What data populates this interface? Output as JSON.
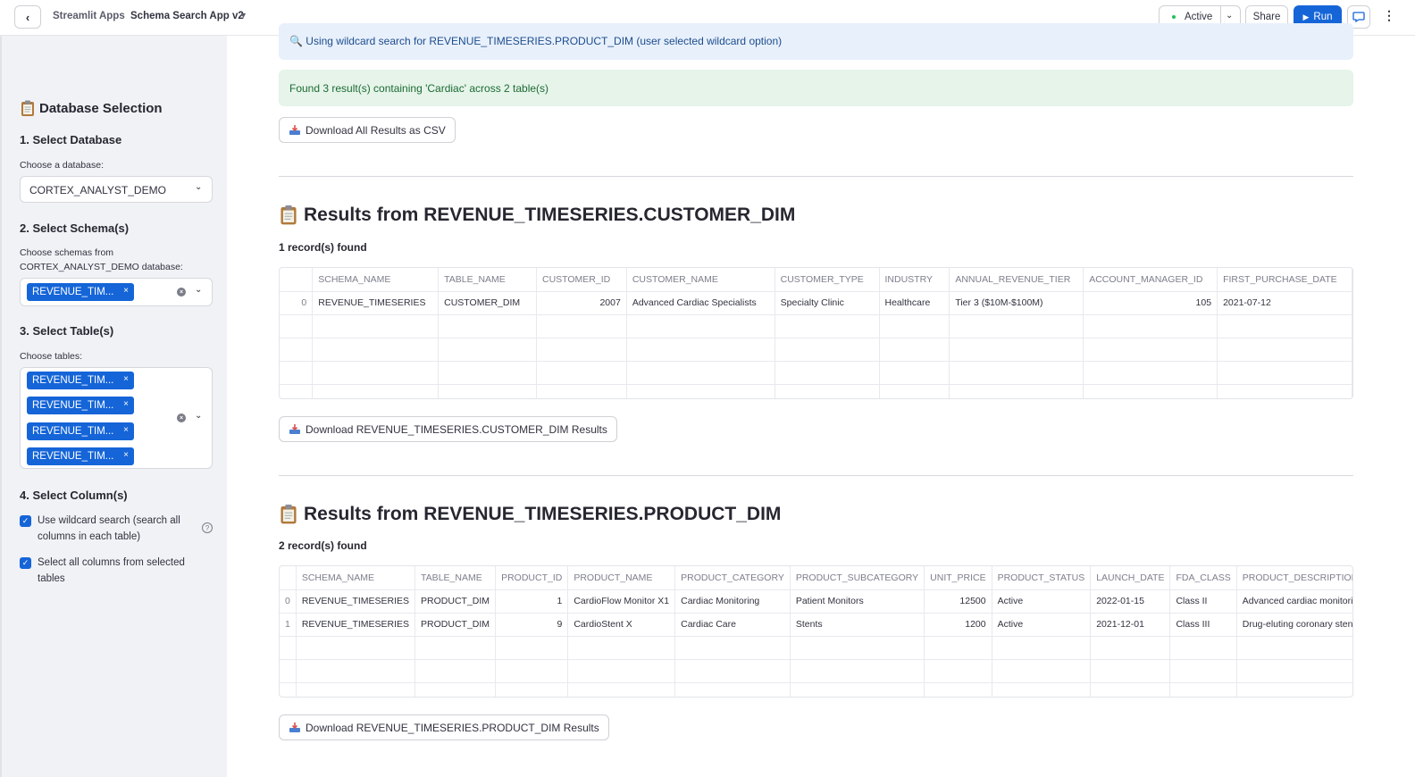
{
  "topbar": {
    "breadcrumb_apps": "Streamlit Apps",
    "app_name": "Schema Search App v2",
    "status_label": "Active",
    "share_label": "Share",
    "run_label": "Run"
  },
  "sidebar": {
    "title": "Database Selection",
    "step1": {
      "heading": "1. Select Database",
      "label": "Choose a database:",
      "value": "CORTEX_ANALYST_DEMO"
    },
    "step2": {
      "heading": "2. Select Schema(s)",
      "label": "Choose schemas from CORTEX_ANALYST_DEMO database:",
      "tags": [
        "REVENUE_TIM..."
      ]
    },
    "step3": {
      "heading": "3. Select Table(s)",
      "label": "Choose tables:",
      "tags": [
        "REVENUE_TIM...",
        "REVENUE_TIM...",
        "REVENUE_TIM...",
        "REVENUE_TIM..."
      ]
    },
    "step4": {
      "heading": "4. Select Column(s)",
      "wildcard_label": "Use wildcard search (search all columns in each table)",
      "all_columns_label": "Select all columns from selected tables"
    }
  },
  "main": {
    "info_text": "Using wildcard search for REVENUE_TIMESERIES.PRODUCT_DIM (user selected wildcard option)",
    "success_text": "Found 3 result(s) containing 'Cardiac' across 2 table(s)",
    "download_all_label": "Download All Results as CSV",
    "sections": [
      {
        "title": "Results from REVENUE_TIMESERIES.CUSTOMER_DIM",
        "records": "1 record(s) found",
        "download_label": "Download REVENUE_TIMESERIES.CUSTOMER_DIM Results",
        "columns": [
          "SCHEMA_NAME",
          "TABLE_NAME",
          "CUSTOMER_ID",
          "CUSTOMER_NAME",
          "CUSTOMER_TYPE",
          "INDUSTRY",
          "ANNUAL_REVENUE_TIER",
          "ACCOUNT_MANAGER_ID",
          "FIRST_PURCHASE_DATE"
        ],
        "rows": [
          [
            "0",
            "REVENUE_TIMESERIES",
            "CUSTOMER_DIM",
            "2007",
            "Advanced Cardiac Specialists",
            "Specialty Clinic",
            "Healthcare",
            "Tier 3 ($10M-$100M)",
            "105",
            "2021-07-12"
          ]
        ]
      },
      {
        "title": "Results from REVENUE_TIMESERIES.PRODUCT_DIM",
        "records": "2 record(s) found",
        "download_label": "Download REVENUE_TIMESERIES.PRODUCT_DIM Results",
        "columns": [
          "SCHEMA_NAME",
          "TABLE_NAME",
          "PRODUCT_ID",
          "PRODUCT_NAME",
          "PRODUCT_CATEGORY",
          "PRODUCT_SUBCATEGORY",
          "UNIT_PRICE",
          "PRODUCT_STATUS",
          "LAUNCH_DATE",
          "FDA_CLASS",
          "PRODUCT_DESCRIPTION"
        ],
        "rows": [
          [
            "0",
            "REVENUE_TIMESERIES",
            "PRODUCT_DIM",
            "1",
            "CardioFlow Monitor X1",
            "Cardiac Monitoring",
            "Patient Monitors",
            "12500",
            "Active",
            "2022-01-15",
            "Class II",
            "Advanced cardiac monitoring sy"
          ],
          [
            "1",
            "REVENUE_TIMESERIES",
            "PRODUCT_DIM",
            "9",
            "CardioStent X",
            "Cardiac Care",
            "Stents",
            "1200",
            "Active",
            "2021-12-01",
            "Class III",
            "Drug-eluting coronary stent"
          ]
        ]
      }
    ]
  }
}
